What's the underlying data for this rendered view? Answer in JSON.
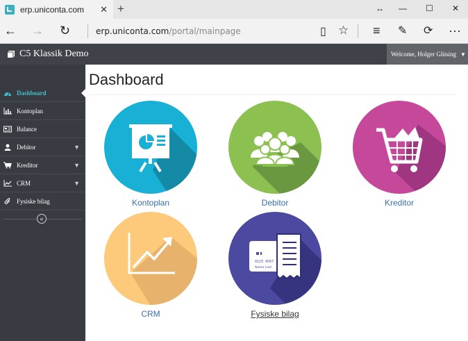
{
  "browser": {
    "tab_title": "erp.uniconta.com",
    "tab_close": "✕",
    "new_tab": "+",
    "address_host": "erp.uniconta.com",
    "address_path": "/portal/mainpage"
  },
  "app": {
    "brand": "C5 Klassik Demo",
    "welcome": "Welcome, Holger Glüsing"
  },
  "sidebar": {
    "items": [
      {
        "label": "Dashboard",
        "icon": "dashboard-icon",
        "active": true
      },
      {
        "label": "Kontoplan",
        "icon": "bar-chart-icon"
      },
      {
        "label": "Balance",
        "icon": "balance-icon"
      },
      {
        "label": "Debitor",
        "icon": "user-icon",
        "expandable": true
      },
      {
        "label": "Kreditor",
        "icon": "cart-icon",
        "expandable": true
      },
      {
        "label": "CRM",
        "icon": "line-chart-icon",
        "expandable": true
      },
      {
        "label": "Fysiske bilag",
        "icon": "paperclip-icon"
      }
    ],
    "collapse": "«"
  },
  "main": {
    "title": "Dashboard",
    "tiles": [
      {
        "label": "Kontoplan",
        "icon": "presentation-icon",
        "color": "#19b0d6"
      },
      {
        "label": "Debitor",
        "icon": "group-icon",
        "color": "#8cc152"
      },
      {
        "label": "Kreditor",
        "icon": "shopping-cart-icon",
        "color": "#c6489b"
      },
      {
        "label": "CRM",
        "icon": "trend-chart-icon",
        "color": "#fdc97a"
      },
      {
        "label": "Fysiske bilag",
        "icon": "card-receipt-icon",
        "color": "#4b4aa0"
      }
    ],
    "card_number": "0123 4567",
    "card_name": "Name  Last"
  },
  "colors": {
    "accent": "#3fc0c9",
    "header": "#3f4349",
    "sidebar": "#383c42"
  }
}
